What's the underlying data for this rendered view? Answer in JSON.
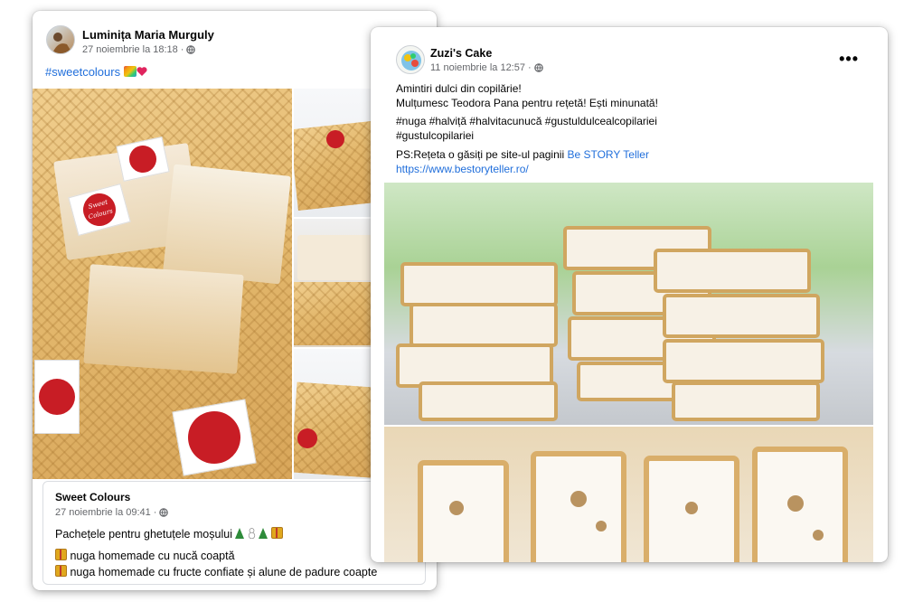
{
  "post_left": {
    "author": "Luminița Maria Murguly",
    "timestamp": "27 noiembrie la 18:18",
    "hashtag": "#sweetcolours",
    "photo_label": "Sweet Colours",
    "shared": {
      "author": "Sweet Colours",
      "timestamp": "27 noiembrie la 09:41",
      "line1": "Pachețele pentru ghetuțele moșului",
      "line2": "nuga homemade cu nucă coaptă",
      "line3": "nuga homemade cu fructe confiate și alune de padure coapte"
    }
  },
  "post_right": {
    "author": "Zuzi's Cake",
    "timestamp": "11 noiembrie la 12:57",
    "line1": "Amintiri dulci din copilărie!",
    "line2": "Mulțumesc Teodora Pana pentru rețetă! Ești minunată!",
    "hashtags1": "#nuga #halviță #halvitacunucă #gustuldulcealcopilariei",
    "hashtags2": "#gustulcopilariei",
    "ps_text": "PS:Rețeta o găsiți pe site-ul paginii",
    "ps_page": "Be STORY Teller",
    "url": "https://www.bestoryteller.ro/",
    "more_label": "•••"
  },
  "colors": {
    "link": "#216fdb",
    "sticker_red": "#c81d25",
    "meta": "#65676b"
  },
  "icons": [
    "globe-icon",
    "more-options-icon",
    "gift-icon",
    "tree-icon",
    "snowman-icon",
    "rainbow-flag-icon",
    "heart-icon"
  ]
}
